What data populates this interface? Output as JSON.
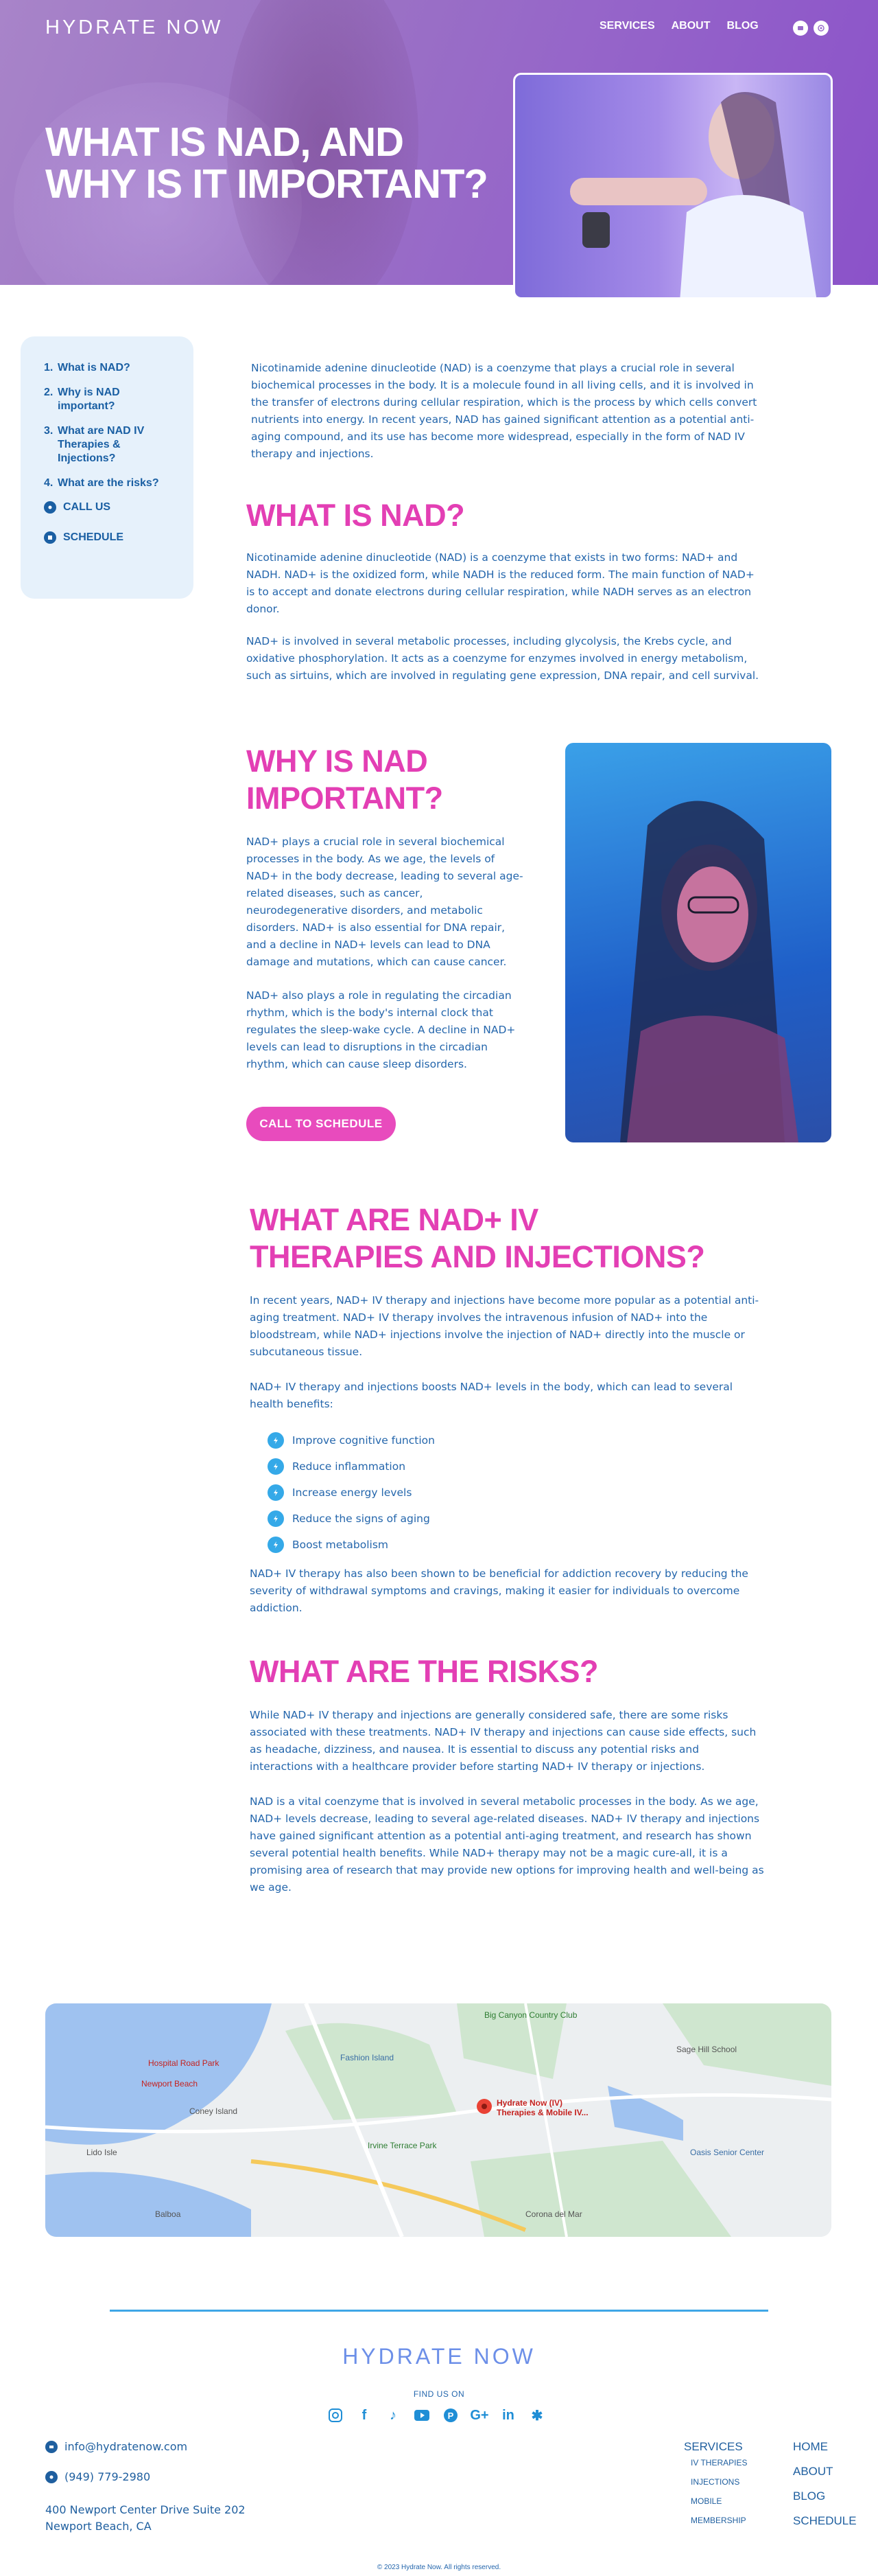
{
  "header": {
    "logo": "HYDRATE NOW",
    "nav": [
      "SERVICES",
      "ABOUT",
      "BLOG"
    ],
    "icons": [
      "chat-icon",
      "whatsapp-icon"
    ]
  },
  "hero": {
    "title": "WHAT IS NAD, AND WHY IS IT IMPORTANT?"
  },
  "toc": {
    "items": [
      {
        "num": "1.",
        "label": "What is NAD?"
      },
      {
        "num": "2.",
        "label": "Why is NAD important?"
      },
      {
        "num": "3.",
        "label": "What are NAD IV Therapies & Injections?"
      },
      {
        "num": "4.",
        "label": "What are the risks?"
      }
    ],
    "call_label": "CALL US",
    "schedule_label": "SCHEDULE"
  },
  "intro": "Nicotinamide adenine dinucleotide (NAD) is a coenzyme that plays a crucial role in several biochemical processes in the body. It is a molecule found in all living cells, and it is involved in the transfer of electrons during cellular respiration, which is the process by which cells convert nutrients into energy. In recent years, NAD has gained significant attention as a potential anti-aging compound, and its use has become more widespread, especially in the form of NAD IV therapy and injections.",
  "what_is": {
    "heading": "WHAT IS NAD?",
    "p1": "Nicotinamide adenine dinucleotide (NAD) is a coenzyme that exists in two forms: NAD+ and NADH. NAD+ is the oxidized form, while NADH is the reduced form. The main function of NAD+ is to accept and donate electrons during cellular respiration, while NADH serves as an electron donor.",
    "p2": "NAD+ is involved in several metabolic processes, including glycolysis, the Krebs cycle, and oxidative phosphorylation. It acts as a coenzyme for enzymes involved in energy metabolism, such as sirtuins, which are involved in regulating gene expression, DNA repair, and cell survival."
  },
  "why": {
    "heading": "WHY IS NAD IMPORTANT?",
    "p1": "NAD+ plays a crucial role in several biochemical processes in the body. As we age, the levels of NAD+ in the body decrease, leading to several age-related diseases, such as cancer, neurodegenerative disorders, and metabolic disorders. NAD+ is also essential for DNA repair, and a decline in NAD+ levels can lead to DNA damage and mutations, which can cause cancer.",
    "p2": "NAD+ also plays a role in regulating the circadian rhythm, which is the body's internal clock that regulates the sleep-wake cycle. A decline in NAD+ levels can lead to disruptions in the circadian rhythm, which can cause sleep disorders.",
    "cta": "CALL TO SCHEDULE"
  },
  "therapies": {
    "heading": "WHAT ARE NAD+ IV THERAPIES AND INJECTIONS?",
    "p1": "In recent years, NAD+ IV therapy and injections have become more popular as a potential anti-aging treatment. NAD+ IV therapy involves the intravenous infusion of NAD+ into the bloodstream, while NAD+ injections involve the injection of NAD+ directly into the muscle or subcutaneous tissue.",
    "p2": "NAD+ IV therapy and injections boosts NAD+ levels in the body, which can lead to several health benefits:",
    "benefits": [
      "Improve cognitive function",
      "Reduce inflammation",
      "Increase energy levels",
      "Reduce the signs of aging",
      "Boost metabolism"
    ],
    "p3": "NAD+ IV therapy has also been shown to be beneficial for addiction recovery by reducing the severity of withdrawal symptoms and cravings, making it easier for individuals to overcome addiction."
  },
  "risks": {
    "heading": "WHAT ARE THE RISKS?",
    "p1": "While NAD+ IV therapy and injections are generally considered safe, there are some risks associated with these treatments. NAD+ IV therapy and injections can cause side effects, such as headache, dizziness, and nausea. It is essential to discuss any potential risks and interactions with a healthcare provider before starting NAD+ IV therapy or injections.",
    "p2": "NAD is a vital coenzyme that is involved in several metabolic processes in the body. As we age, NAD+ levels decrease, leading to several age-related diseases. NAD+ IV therapy and injections have gained significant attention as a potential anti-aging treatment, and research has shown several potential health benefits. While NAD+ therapy may not be a magic cure-all, it is a promising area of research that may provide new options for improving health and well-being as we age."
  },
  "map": {
    "labels": [
      "Hydrate Now (IV) Therapies & Mobile IV...",
      "Fashion Island",
      "Newport Beach",
      "Corona del Mar",
      "Big Canyon Country Club",
      "Sage Hill School",
      "Oasis Senior Center",
      "Irvine Terrace Park",
      "Lido Isle",
      "Balboa",
      "Coney Island",
      "Hospital Road Park"
    ]
  },
  "footer": {
    "logo": "HYDRATE NOW",
    "find_us": "FIND US ON",
    "socials": [
      "instagram-icon",
      "facebook-icon",
      "tiktok-icon",
      "youtube-icon",
      "pinterest-icon",
      "google-plus-icon",
      "linkedin-icon",
      "yelp-icon"
    ],
    "email": "info@hydratenow.com",
    "phone": "(949) 779-2980",
    "address_line1": "400 Newport Center Drive Suite 202",
    "address_line2": "Newport Beach, CA",
    "services": "SERVICES",
    "services_sub": [
      "IV THERAPIES",
      "INJECTIONS",
      "MOBILE",
      "MEMBERSHIP"
    ],
    "links": [
      "HOME",
      "ABOUT",
      "BLOG",
      "SCHEDULE"
    ],
    "copyright": "© 2023 Hydrate Now. All rights reserved."
  }
}
